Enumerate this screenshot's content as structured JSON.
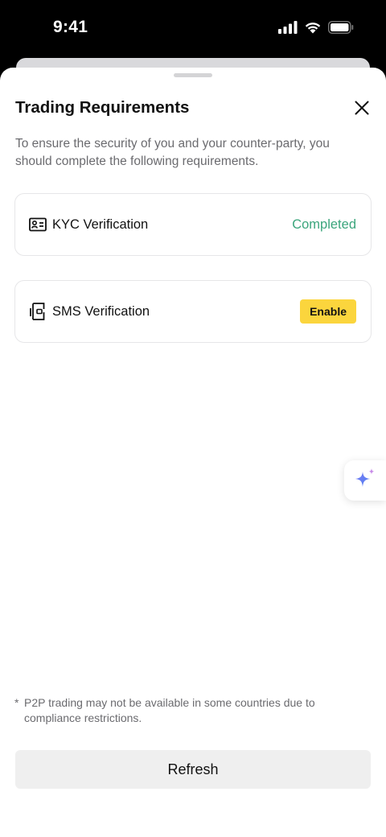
{
  "status_bar": {
    "time": "9:41",
    "icons": [
      "cellular-signal-icon",
      "wifi-icon",
      "battery-icon"
    ]
  },
  "sheet": {
    "title": "Trading Requirements",
    "close_icon": "close-icon",
    "description": "To ensure the security of you and your counter-party, you should complete the following requirements.",
    "requirements": [
      {
        "icon": "id-card-icon",
        "label": "KYC Verification",
        "status": "Completed",
        "status_color": "#3ba57c"
      },
      {
        "icon": "phone-icon",
        "label": "SMS Verification",
        "action": "Enable",
        "action_color": "#fbd53d"
      }
    ],
    "ai_assistant_icon": "sparkle-icon",
    "footnote_mark": "*",
    "footnote": "P2P trading may not be available in some countries due to compliance restrictions.",
    "refresh_label": "Refresh"
  }
}
